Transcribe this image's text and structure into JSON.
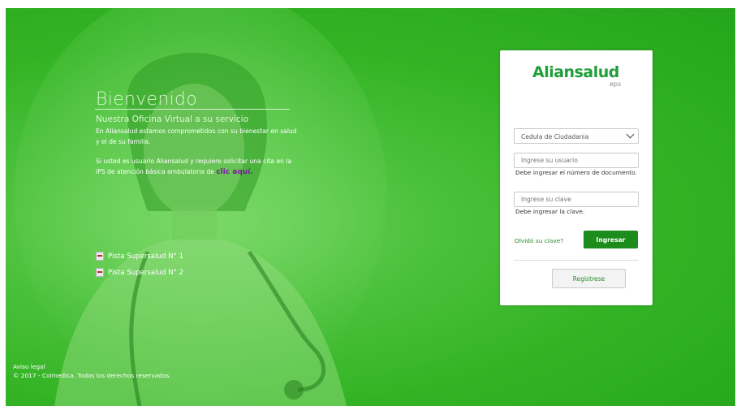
{
  "welcome": {
    "title": "Bienvenido",
    "subtitle": "Nuestra Oficina Virtual a su servicio",
    "p1": "En Aliansalud estamos comprometidos con su bienestar en salud y el de su familia.",
    "p2_prefix": "Si usted es usuario Aliansalud y requiere solicitar una cita en la IPS de atención básica ambulatoria de",
    "p2_link": "clic aquí."
  },
  "links": {
    "pista1": "Pista Supersalud N° 1",
    "pista2": "Pista Supersalud N° 2"
  },
  "footer": {
    "legal": "Aviso legal",
    "copyright": "© 2017 - Colmedica. Todos los derechos reservados."
  },
  "login": {
    "logo_text": "Aliansalud",
    "logo_sub": "eps",
    "doc_type_selected": "Cedula de Ciudadania",
    "user_placeholder": "Ingrese su usuario",
    "user_hint": "Debe ingresar el número de documento.",
    "pass_placeholder": "Ingrese su clave",
    "pass_hint": "Debe ingresar la clave.",
    "forgot": "Olvidó su clave?",
    "submit": "Ingresar",
    "register": "Registrese"
  },
  "colors": {
    "background": "#33b324",
    "brand": "#1f9e3a",
    "button": "#1c8c1c",
    "link": "#7a1aa0"
  }
}
